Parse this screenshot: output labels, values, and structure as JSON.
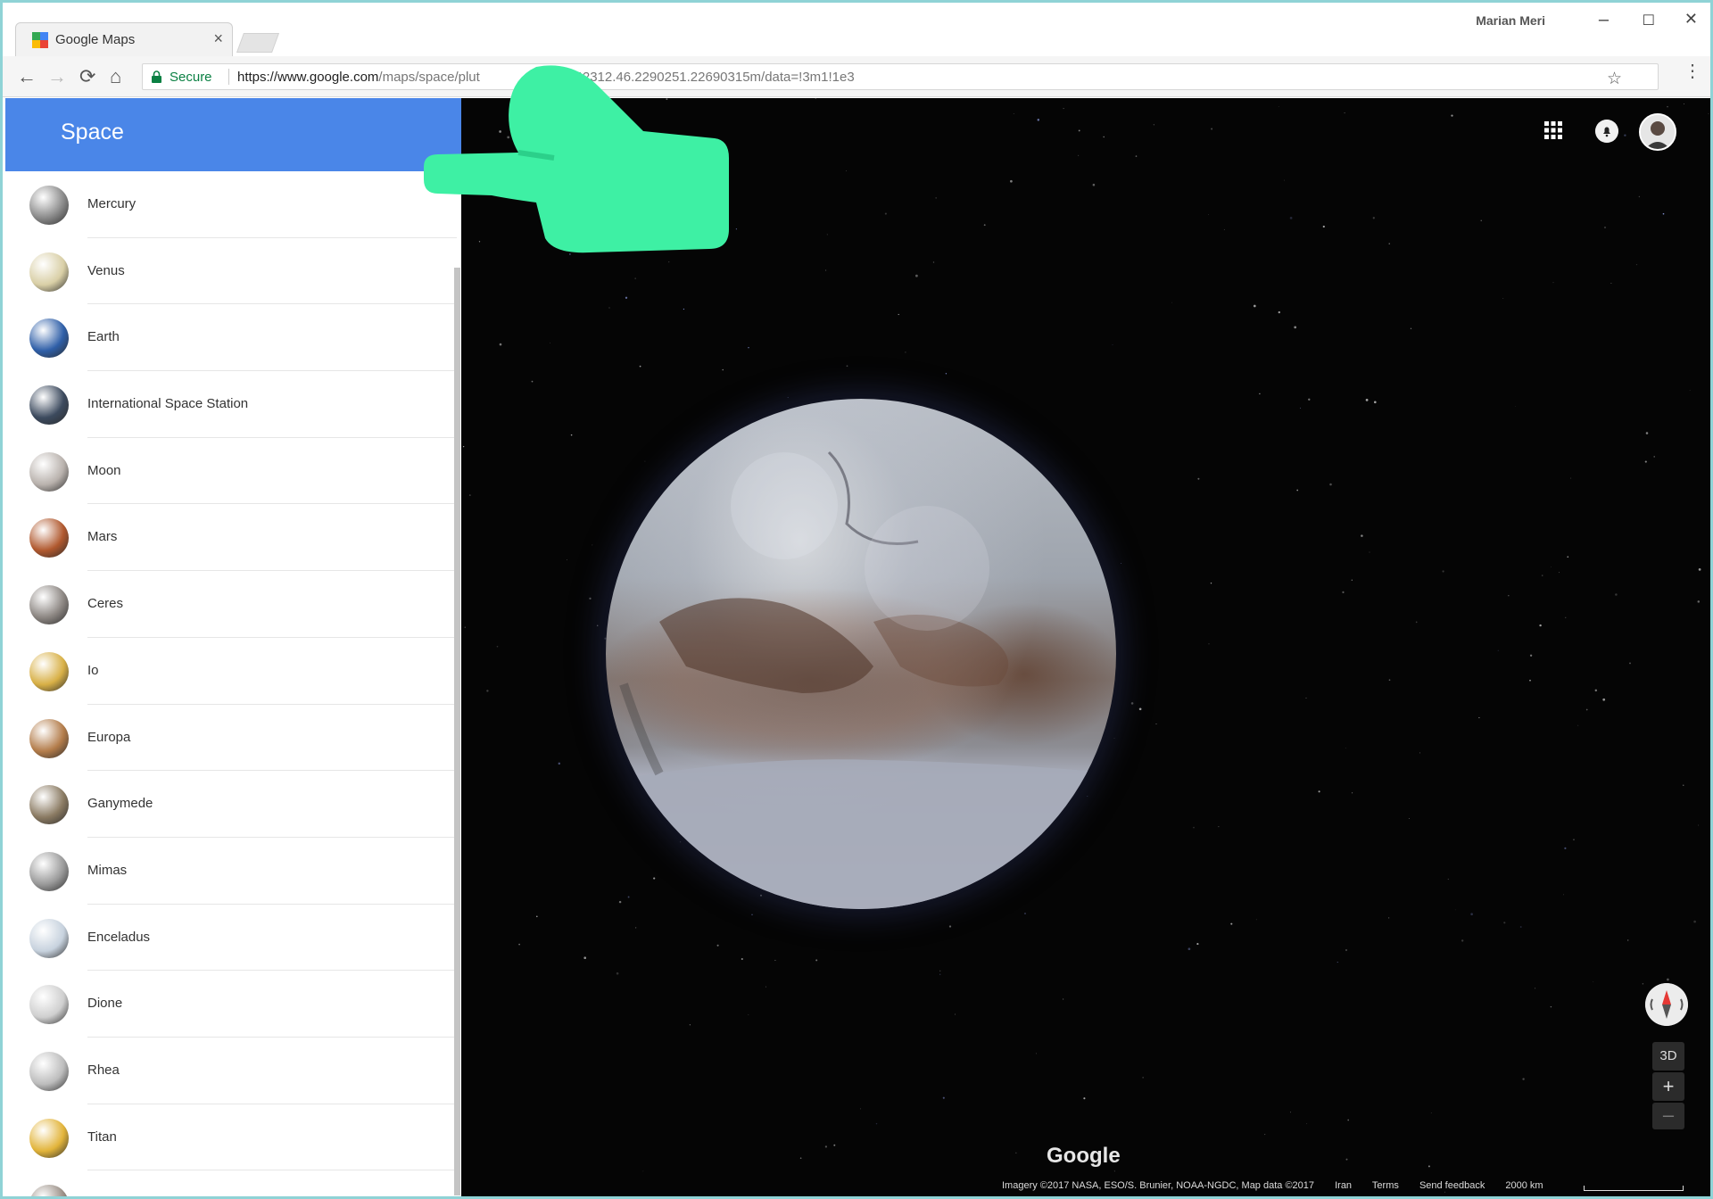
{
  "browser": {
    "tab_title": "Google Maps",
    "tab_close": "×",
    "user_name": "Marian Meri",
    "window_controls": {
      "minimize": "–",
      "maximize": "☐",
      "close": "✕"
    },
    "nav": {
      "back": "←",
      "forward": "→",
      "reload": "⟳",
      "home": "⌂"
    },
    "secure_label": "Secure",
    "url_host": "https://www.google.com",
    "url_path": "/maps/space/plut",
    "url_tail": "6242312.46.2290251.22690315m/data=!3m1!1e3",
    "star": "☆",
    "menu": "⋮"
  },
  "sidebar": {
    "title": "Space",
    "items": [
      {
        "label": "Mercury",
        "color": "#8a8a8a"
      },
      {
        "label": "Venus",
        "color": "#d9cfa6"
      },
      {
        "label": "Earth",
        "color": "#2f5fa8"
      },
      {
        "label": "International Space Station",
        "color": "#3c4a5e"
      },
      {
        "label": "Moon",
        "color": "#b9b2ad"
      },
      {
        "label": "Mars",
        "color": "#b0582e"
      },
      {
        "label": "Ceres",
        "color": "#8c8682"
      },
      {
        "label": "Io",
        "color": "#d8b046"
      },
      {
        "label": "Europa",
        "color": "#b37c4a"
      },
      {
        "label": "Ganymede",
        "color": "#8a7a62"
      },
      {
        "label": "Mimas",
        "color": "#9a9a9a"
      },
      {
        "label": "Enceladus",
        "color": "#c7d2de"
      },
      {
        "label": "Dione",
        "color": "#cfcfcf"
      },
      {
        "label": "Rhea",
        "color": "#bdbdbd"
      },
      {
        "label": "Titan",
        "color": "#e2b43a"
      },
      {
        "label": "",
        "color": "#9a8f86"
      }
    ]
  },
  "map": {
    "logo": "Google",
    "attribution": {
      "imagery": "Imagery ©2017 NASA, ESO/S. Brunier, NOAA-NGDC, Map data ©2017",
      "region": "Iran",
      "terms": "Terms",
      "feedback": "Send feedback",
      "scale": "2000 km"
    },
    "controls": {
      "three_d": "3D",
      "zoom_in": "+",
      "zoom_out": "–"
    }
  },
  "colors": {
    "header_blue": "#4a86e8",
    "hand_green": "#3ef0a4",
    "space_black": "#050505"
  }
}
